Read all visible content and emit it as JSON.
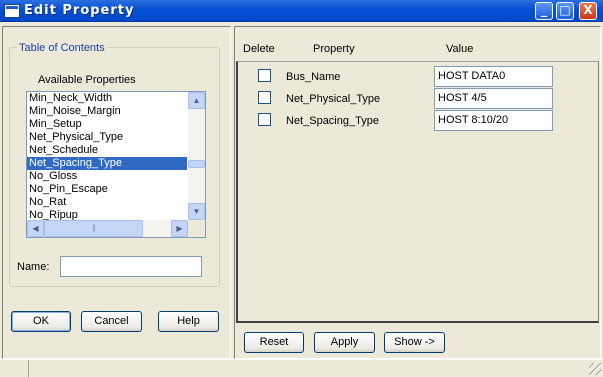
{
  "window": {
    "title": "Edit Property",
    "controls": [
      "_",
      "□",
      "X"
    ]
  },
  "toc": {
    "title": "Table of Contents",
    "available_label": "Available Properties",
    "properties": [
      "Min_Neck_Width",
      "Min_Noise_Margin",
      "Min_Setup",
      "Net_Physical_Type",
      "Net_Schedule",
      "Net_Spacing_Type",
      "No_Gloss",
      "No_Pin_Escape",
      "No_Rat",
      "No_Ripup"
    ],
    "selected_property": "Net_Spacing_Type",
    "name_label": "Name:",
    "name_value": ""
  },
  "grid": {
    "headers": {
      "delete": "Delete",
      "property": "Property",
      "value": "Value"
    },
    "rows": [
      {
        "property": "Bus_Name",
        "value": "HOST DATA0",
        "delete_checked": false
      },
      {
        "property": "Net_Physical_Type",
        "value": "HOST 4/5",
        "delete_checked": false
      },
      {
        "property": "Net_Spacing_Type",
        "value": "HOST 8:10/20",
        "delete_checked": false
      }
    ]
  },
  "buttons": {
    "ok": "OK",
    "cancel": "Cancel",
    "help": "Help",
    "reset": "Reset",
    "apply": "Apply",
    "show": "Show ->"
  },
  "colors": {
    "title_bar": "#0a52d6",
    "selection": "#316ac5",
    "group_title": "#1c3fa8"
  }
}
